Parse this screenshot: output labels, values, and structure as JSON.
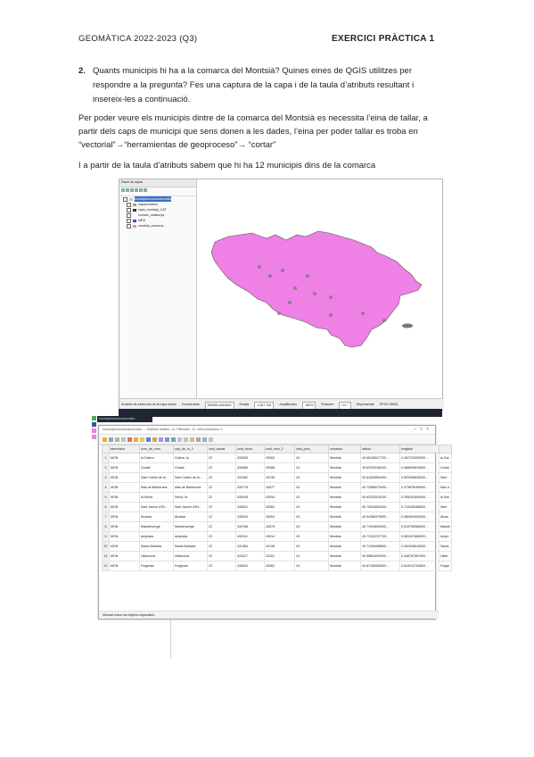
{
  "header": {
    "left": "GEOMÀTICA 2022-2023 (Q3)",
    "right": "EXERCICI PRÀCTICA 1"
  },
  "question": {
    "number": "2.",
    "line1": "Quants municipis hi ha a la comarca del Montsià? Quines eines de QGIS utilitzes per",
    "line2": "respondre a la pregunta? Fes una captura de la capa i de la taula d’atributs resultant i",
    "line3": "insereix-les a continuació."
  },
  "answer": {
    "line1": "Per poder veure els municipis dintre de la comarca del Montsià es necessita l’eina de tallar, a",
    "line2": "partir dels caps de municipi que sens donen a les dades, l’eina per poder tallar es troba en",
    "line3": "“vectorial”→“herramientas de geoproceso”→ “cortar”",
    "line4": "I a partir de la taula d’atributs sabem que hi ha 12 municipis dins de la comarca"
  },
  "qgis": {
    "panel_title": "Panel de capas",
    "layers": [
      {
        "name": "municipiscomarcamontsia",
        "color": "#c8c8c8"
      },
      {
        "name": "capacomarca",
        "color": "#7cba5a"
      },
      {
        "name": "caps_municipi_CAT",
        "color": "#333333"
      },
      {
        "name": "comarc_catalunya",
        "color": "#ffffff"
      },
      {
        "name": "MRS",
        "color": "#3355aa"
      },
      {
        "name": "montsia_comarca",
        "color": "#ee7fe0"
      }
    ],
    "status": {
      "left": "Arrastre de selección de la capa activa",
      "coord_label": "Coordenada",
      "coord_value": "283965,4543820",
      "scale_label": "Escala",
      "scale_value": "1:487.754",
      "magnifier_label": "Amplificador",
      "magnifier_value": "100%",
      "rotation_label": "Rotación",
      "rotation_value": "0,0 °",
      "render_label": "Representar",
      "crs": "EPSG:25831"
    },
    "taskbar_label": "municipiscomarcamontsia"
  },
  "colors": {
    "region_fill": "#ee80e6",
    "region_stroke": "#555555",
    "point": "#8a8a8a"
  },
  "attribute_table": {
    "title": "municipiscomarcamontsia — Objetos totales: 12, Filtrados: 12, seleccionados: 0",
    "columns": [
      "abreviatur",
      "nom_de_mun",
      "cap_de_m_2",
      "codi_comar",
      "codi_munc",
      "codi_mun_2",
      "codi_prov_",
      "comarca",
      "latitud",
      "longitud",
      ""
    ],
    "rows": [
      [
        "MON",
        "la Galera",
        "Galera, la",
        "22",
        "430635",
        "43063",
        "43",
        "Montsià",
        "40.68155617700...",
        "0.462722930099...",
        "la Gal"
      ],
      [
        "MON",
        "Godall",
        "Godall",
        "22",
        "430686",
        "43068",
        "43",
        "Montsià",
        "40.63339246400...",
        "0.468659615500...",
        "Godal"
      ],
      [
        "MON",
        "Sant Carles de la...",
        "Sant Carles de la...",
        "22",
        "431362",
        "43136",
        "43",
        "Montsià",
        "40.61626984400...",
        "0.593536638300...",
        "Sant"
      ],
      [
        "MON",
        "Mas de Barberans",
        "Mas de Barberans",
        "22",
        "430776",
        "43077",
        "43",
        "Montsià",
        "40.73586675400...",
        "0.373878189900...",
        "Mas d"
      ],
      [
        "MON",
        "la Sénia",
        "Sénia, la",
        "22",
        "430445",
        "43044",
        "43",
        "Montsià",
        "40.63332818100...",
        "0.285251604000...",
        "la Sén"
      ],
      [
        "MON",
        "Sant Jaume d'En...",
        "Sant Jaume d'En...",
        "22",
        "430621",
        "43062",
        "43",
        "Montsià",
        "40.70004652000...",
        "0.715168488800...",
        "Sant"
      ],
      [
        "MON",
        "Alcanar",
        "Alcanar",
        "22",
        "430043",
        "43004",
        "43",
        "Montsià",
        "40.54386379900...",
        "0.480964053000...",
        "Alcan"
      ],
      [
        "MON",
        "Masdenverge",
        "Masdenverge",
        "22",
        "430786",
        "43078",
        "43",
        "Montsià",
        "40.71944600000...",
        "0.515705986000...",
        "Masde"
      ],
      [
        "MON",
        "Amposta",
        "Amposta",
        "22",
        "430141",
        "43014",
        "43",
        "Montsià",
        "40.71242237700...",
        "0.581007680000...",
        "Ampo"
      ],
      [
        "MON",
        "Santa Bàrbara",
        "Santa Bàrbara",
        "22",
        "431384",
        "43138",
        "43",
        "Montsià",
        "40.71499498800...",
        "0.492628616000...",
        "Santa"
      ],
      [
        "MON",
        "Ulldecona",
        "Ulldecona",
        "22",
        "431617",
        "43161",
        "43",
        "Montsià",
        "40.59804209200...",
        "0.446767667000...",
        "Ullde"
      ],
      [
        "MON",
        "Freginals",
        "Freginals",
        "22",
        "430620",
        "43062",
        "43",
        "Montsià",
        "40.67185550600...",
        "0.519012754800...",
        "Fregin"
      ]
    ],
    "footer": "Mostrar todos los objetos espaciales"
  }
}
